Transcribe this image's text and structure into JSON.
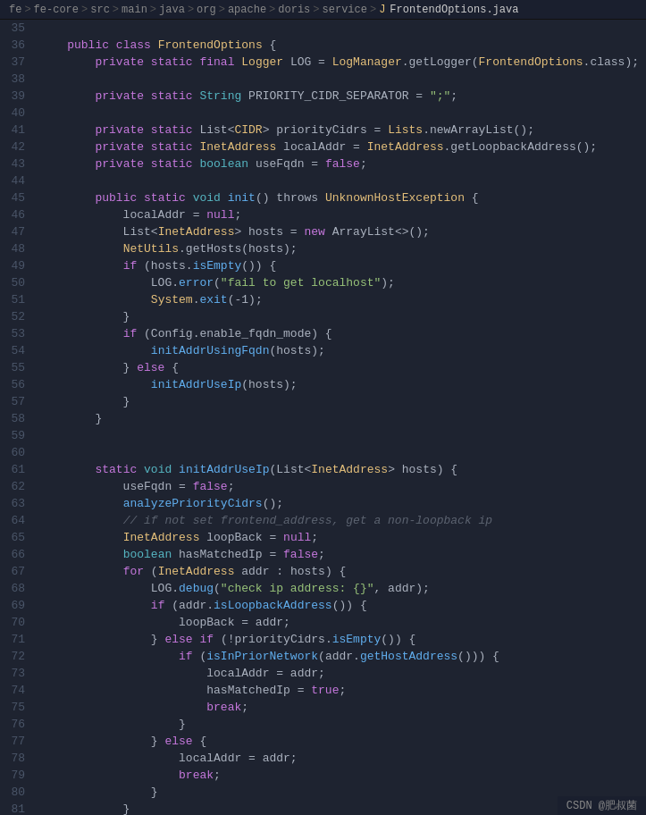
{
  "breadcrumb": {
    "items": [
      "fe",
      "fe-core",
      "src",
      "main",
      "java",
      "org",
      "apache",
      "doris",
      "service"
    ],
    "file": "FrontendOptions.java"
  },
  "footer": {
    "text": "CSDN @肥叔菌"
  },
  "lines": [
    {
      "num": 35,
      "tokens": []
    },
    {
      "num": 36,
      "tokens": [
        {
          "t": "    ",
          "c": "plain"
        },
        {
          "t": "public",
          "c": "kw"
        },
        {
          "t": " ",
          "c": "plain"
        },
        {
          "t": "class",
          "c": "kw"
        },
        {
          "t": " ",
          "c": "plain"
        },
        {
          "t": "FrontendOptions",
          "c": "class-name"
        },
        {
          "t": " {",
          "c": "plain"
        }
      ]
    },
    {
      "num": 37,
      "tokens": [
        {
          "t": "        ",
          "c": "plain"
        },
        {
          "t": "private",
          "c": "kw"
        },
        {
          "t": " ",
          "c": "plain"
        },
        {
          "t": "static",
          "c": "kw"
        },
        {
          "t": " ",
          "c": "plain"
        },
        {
          "t": "final",
          "c": "kw"
        },
        {
          "t": " ",
          "c": "plain"
        },
        {
          "t": "Logger",
          "c": "class-name"
        },
        {
          "t": " LOG = ",
          "c": "plain"
        },
        {
          "t": "LogManager",
          "c": "class-name"
        },
        {
          "t": ".getLogger(",
          "c": "plain"
        },
        {
          "t": "FrontendOptions",
          "c": "class-name"
        },
        {
          "t": ".class);",
          "c": "plain"
        }
      ]
    },
    {
      "num": 38,
      "tokens": []
    },
    {
      "num": 39,
      "tokens": [
        {
          "t": "        ",
          "c": "plain"
        },
        {
          "t": "private",
          "c": "kw"
        },
        {
          "t": " ",
          "c": "plain"
        },
        {
          "t": "static",
          "c": "kw"
        },
        {
          "t": " ",
          "c": "plain"
        },
        {
          "t": "String",
          "c": "type"
        },
        {
          "t": " PRIORITY_CIDR_SEPARATOR = ",
          "c": "plain"
        },
        {
          "t": "\";\"",
          "c": "str"
        },
        {
          "t": ";",
          "c": "plain"
        }
      ]
    },
    {
      "num": 40,
      "tokens": []
    },
    {
      "num": 41,
      "tokens": [
        {
          "t": "        ",
          "c": "plain"
        },
        {
          "t": "private",
          "c": "kw"
        },
        {
          "t": " ",
          "c": "plain"
        },
        {
          "t": "static",
          "c": "kw"
        },
        {
          "t": " List<",
          "c": "plain"
        },
        {
          "t": "CIDR",
          "c": "class-name"
        },
        {
          "t": "> priorityCidrs = ",
          "c": "plain"
        },
        {
          "t": "Lists",
          "c": "class-name"
        },
        {
          "t": ".newArrayList();",
          "c": "plain"
        }
      ]
    },
    {
      "num": 42,
      "tokens": [
        {
          "t": "        ",
          "c": "plain"
        },
        {
          "t": "private",
          "c": "kw"
        },
        {
          "t": " ",
          "c": "plain"
        },
        {
          "t": "static",
          "c": "kw"
        },
        {
          "t": " ",
          "c": "plain"
        },
        {
          "t": "InetAddress",
          "c": "class-name"
        },
        {
          "t": " localAddr = ",
          "c": "plain"
        },
        {
          "t": "InetAddress",
          "c": "class-name"
        },
        {
          "t": ".getLoopbackAddress();",
          "c": "plain"
        }
      ]
    },
    {
      "num": 43,
      "tokens": [
        {
          "t": "        ",
          "c": "plain"
        },
        {
          "t": "private",
          "c": "kw"
        },
        {
          "t": " ",
          "c": "plain"
        },
        {
          "t": "static",
          "c": "kw"
        },
        {
          "t": " ",
          "c": "plain"
        },
        {
          "t": "boolean",
          "c": "type"
        },
        {
          "t": " useFqdn = ",
          "c": "plain"
        },
        {
          "t": "false",
          "c": "kw"
        },
        {
          "t": ";",
          "c": "plain"
        }
      ]
    },
    {
      "num": 44,
      "tokens": []
    },
    {
      "num": 45,
      "tokens": [
        {
          "t": "        ",
          "c": "plain"
        },
        {
          "t": "public",
          "c": "kw"
        },
        {
          "t": " ",
          "c": "plain"
        },
        {
          "t": "static",
          "c": "kw"
        },
        {
          "t": " ",
          "c": "plain"
        },
        {
          "t": "void",
          "c": "type"
        },
        {
          "t": " ",
          "c": "plain"
        },
        {
          "t": "init",
          "c": "fn"
        },
        {
          "t": "() throws ",
          "c": "plain"
        },
        {
          "t": "UnknownHostException",
          "c": "class-name"
        },
        {
          "t": " {",
          "c": "plain"
        }
      ]
    },
    {
      "num": 46,
      "tokens": [
        {
          "t": "            localAddr = ",
          "c": "plain"
        },
        {
          "t": "null",
          "c": "kw"
        },
        {
          "t": ";",
          "c": "plain"
        }
      ]
    },
    {
      "num": 47,
      "tokens": [
        {
          "t": "            List<",
          "c": "plain"
        },
        {
          "t": "InetAddress",
          "c": "class-name"
        },
        {
          "t": "> hosts = ",
          "c": "plain"
        },
        {
          "t": "new",
          "c": "kw"
        },
        {
          "t": " ArrayList<>();",
          "c": "plain"
        }
      ]
    },
    {
      "num": 48,
      "tokens": [
        {
          "t": "            ",
          "c": "plain"
        },
        {
          "t": "NetUtils",
          "c": "class-name"
        },
        {
          "t": ".getHosts(hosts);",
          "c": "plain"
        }
      ]
    },
    {
      "num": 49,
      "tokens": [
        {
          "t": "            ",
          "c": "plain"
        },
        {
          "t": "if",
          "c": "kw"
        },
        {
          "t": " (hosts.",
          "c": "plain"
        },
        {
          "t": "isEmpty",
          "c": "fn"
        },
        {
          "t": "()) {",
          "c": "plain"
        }
      ]
    },
    {
      "num": 50,
      "tokens": [
        {
          "t": "                LOG.",
          "c": "plain"
        },
        {
          "t": "error",
          "c": "fn"
        },
        {
          "t": "(",
          "c": "plain"
        },
        {
          "t": "\"fail to get localhost\"",
          "c": "str"
        },
        {
          "t": ");",
          "c": "plain"
        }
      ]
    },
    {
      "num": 51,
      "tokens": [
        {
          "t": "                ",
          "c": "plain"
        },
        {
          "t": "System",
          "c": "class-name"
        },
        {
          "t": ".",
          "c": "plain"
        },
        {
          "t": "exit",
          "c": "fn"
        },
        {
          "t": "(-1);",
          "c": "plain"
        }
      ]
    },
    {
      "num": 52,
      "tokens": [
        {
          "t": "            }",
          "c": "plain"
        }
      ]
    },
    {
      "num": 53,
      "tokens": [
        {
          "t": "            ",
          "c": "plain"
        },
        {
          "t": "if",
          "c": "kw"
        },
        {
          "t": " (Config.enable_fqdn_mode) {",
          "c": "plain"
        }
      ]
    },
    {
      "num": 54,
      "tokens": [
        {
          "t": "                ",
          "c": "plain"
        },
        {
          "t": "initAddrUsingFqdn",
          "c": "fn"
        },
        {
          "t": "(hosts);",
          "c": "plain"
        }
      ]
    },
    {
      "num": 55,
      "tokens": [
        {
          "t": "            } ",
          "c": "plain"
        },
        {
          "t": "else",
          "c": "kw"
        },
        {
          "t": " {",
          "c": "plain"
        }
      ]
    },
    {
      "num": 56,
      "tokens": [
        {
          "t": "                ",
          "c": "plain"
        },
        {
          "t": "initAddrUseIp",
          "c": "fn"
        },
        {
          "t": "(hosts);",
          "c": "plain"
        }
      ]
    },
    {
      "num": 57,
      "tokens": [
        {
          "t": "            }",
          "c": "plain"
        }
      ]
    },
    {
      "num": 58,
      "tokens": [
        {
          "t": "        }",
          "c": "plain"
        }
      ]
    },
    {
      "num": 59,
      "tokens": []
    },
    {
      "num": 60,
      "tokens": []
    },
    {
      "num": 61,
      "tokens": [
        {
          "t": "        ",
          "c": "plain"
        },
        {
          "t": "static",
          "c": "kw"
        },
        {
          "t": " ",
          "c": "plain"
        },
        {
          "t": "void",
          "c": "type"
        },
        {
          "t": " ",
          "c": "plain"
        },
        {
          "t": "initAddrUseIp",
          "c": "fn"
        },
        {
          "t": "(List<",
          "c": "plain"
        },
        {
          "t": "InetAddress",
          "c": "class-name"
        },
        {
          "t": "> hosts) {",
          "c": "plain"
        }
      ]
    },
    {
      "num": 62,
      "tokens": [
        {
          "t": "            useFqdn = ",
          "c": "plain"
        },
        {
          "t": "false",
          "c": "kw"
        },
        {
          "t": ";",
          "c": "plain"
        }
      ]
    },
    {
      "num": 63,
      "tokens": [
        {
          "t": "            ",
          "c": "plain"
        },
        {
          "t": "analyzePriorityCidrs",
          "c": "fn"
        },
        {
          "t": "();",
          "c": "plain"
        }
      ]
    },
    {
      "num": 64,
      "tokens": [
        {
          "t": "            ",
          "c": "comment"
        },
        {
          "t": "// if not set frontend_address, get a non-loopback ip",
          "c": "comment"
        }
      ]
    },
    {
      "num": 65,
      "tokens": [
        {
          "t": "            ",
          "c": "plain"
        },
        {
          "t": "InetAddress",
          "c": "class-name"
        },
        {
          "t": " loopBack = ",
          "c": "plain"
        },
        {
          "t": "null",
          "c": "kw"
        },
        {
          "t": ";",
          "c": "plain"
        }
      ]
    },
    {
      "num": 66,
      "tokens": [
        {
          "t": "            ",
          "c": "plain"
        },
        {
          "t": "boolean",
          "c": "type"
        },
        {
          "t": " hasMatchedIp = ",
          "c": "plain"
        },
        {
          "t": "false",
          "c": "kw"
        },
        {
          "t": ";",
          "c": "plain"
        }
      ]
    },
    {
      "num": 67,
      "tokens": [
        {
          "t": "            ",
          "c": "plain"
        },
        {
          "t": "for",
          "c": "kw"
        },
        {
          "t": " (",
          "c": "plain"
        },
        {
          "t": "InetAddress",
          "c": "class-name"
        },
        {
          "t": " addr : hosts) {",
          "c": "plain"
        }
      ]
    },
    {
      "num": 68,
      "tokens": [
        {
          "t": "                LOG.",
          "c": "plain"
        },
        {
          "t": "debug",
          "c": "fn"
        },
        {
          "t": "(",
          "c": "plain"
        },
        {
          "t": "\"check ip address: {}\"",
          "c": "str"
        },
        {
          "t": ", addr);",
          "c": "plain"
        }
      ]
    },
    {
      "num": 69,
      "tokens": [
        {
          "t": "                ",
          "c": "plain"
        },
        {
          "t": "if",
          "c": "kw"
        },
        {
          "t": " (addr.",
          "c": "plain"
        },
        {
          "t": "isLoopbackAddress",
          "c": "fn"
        },
        {
          "t": "()) {",
          "c": "plain"
        }
      ]
    },
    {
      "num": 70,
      "tokens": [
        {
          "t": "                    loopBack = addr;",
          "c": "plain"
        }
      ]
    },
    {
      "num": 71,
      "tokens": [
        {
          "t": "                } ",
          "c": "plain"
        },
        {
          "t": "else",
          "c": "kw"
        },
        {
          "t": " ",
          "c": "plain"
        },
        {
          "t": "if",
          "c": "kw"
        },
        {
          "t": " (!priorityCidrs.",
          "c": "plain"
        },
        {
          "t": "isEmpty",
          "c": "fn"
        },
        {
          "t": "()) {",
          "c": "plain"
        }
      ]
    },
    {
      "num": 72,
      "tokens": [
        {
          "t": "                    ",
          "c": "plain"
        },
        {
          "t": "if",
          "c": "kw"
        },
        {
          "t": " (",
          "c": "plain"
        },
        {
          "t": "isInPriorNetwork",
          "c": "fn"
        },
        {
          "t": "(addr.",
          "c": "plain"
        },
        {
          "t": "getHostAddress",
          "c": "fn"
        },
        {
          "t": "())) {",
          "c": "plain"
        }
      ]
    },
    {
      "num": 73,
      "tokens": [
        {
          "t": "                        localAddr = addr;",
          "c": "plain"
        }
      ]
    },
    {
      "num": 74,
      "tokens": [
        {
          "t": "                        hasMatchedIp = ",
          "c": "plain"
        },
        {
          "t": "true",
          "c": "kw"
        },
        {
          "t": ";",
          "c": "plain"
        }
      ]
    },
    {
      "num": 75,
      "tokens": [
        {
          "t": "                        ",
          "c": "plain"
        },
        {
          "t": "break",
          "c": "kw"
        },
        {
          "t": ";",
          "c": "plain"
        }
      ]
    },
    {
      "num": 76,
      "tokens": [
        {
          "t": "                    }",
          "c": "plain"
        }
      ]
    },
    {
      "num": 77,
      "tokens": [
        {
          "t": "                } ",
          "c": "plain"
        },
        {
          "t": "else",
          "c": "kw"
        },
        {
          "t": " {",
          "c": "plain"
        }
      ]
    },
    {
      "num": 78,
      "tokens": [
        {
          "t": "                    localAddr = addr;",
          "c": "plain"
        }
      ]
    },
    {
      "num": 79,
      "tokens": [
        {
          "t": "                    ",
          "c": "plain"
        },
        {
          "t": "break",
          "c": "kw"
        },
        {
          "t": ";",
          "c": "plain"
        }
      ]
    },
    {
      "num": 80,
      "tokens": [
        {
          "t": "                }",
          "c": "plain"
        }
      ]
    },
    {
      "num": 81,
      "tokens": [
        {
          "t": "            }",
          "c": "plain"
        }
      ]
    }
  ]
}
